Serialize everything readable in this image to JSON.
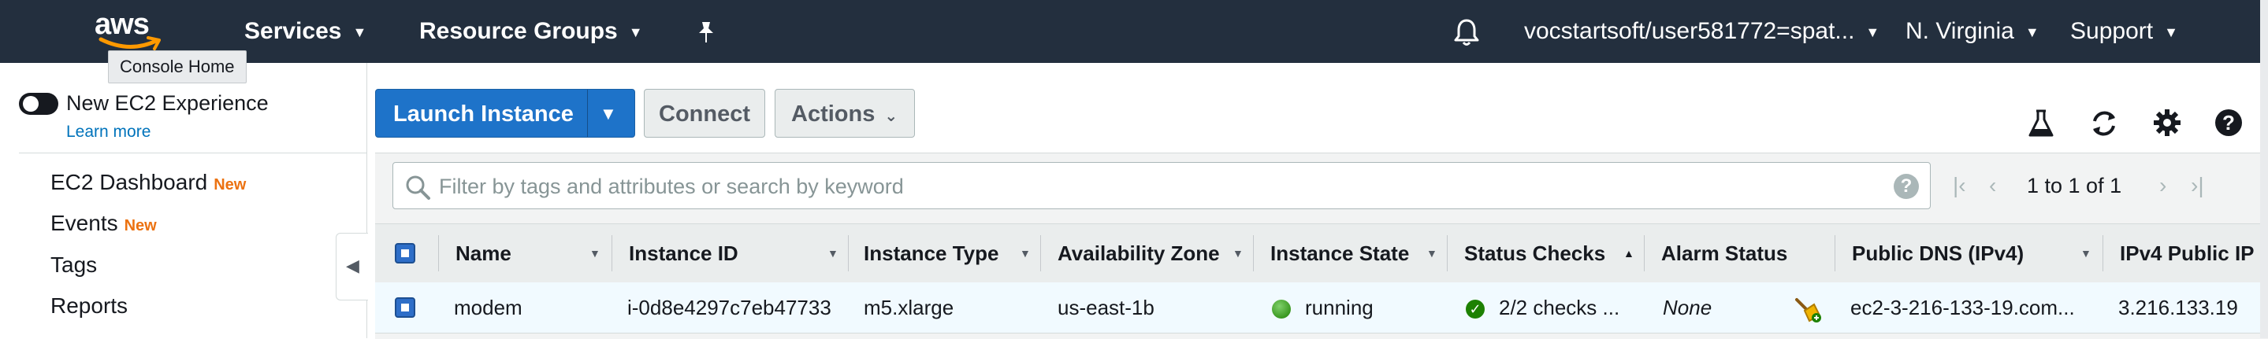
{
  "topnav": {
    "logo_text": "aws",
    "services": "Services",
    "resource_groups": "Resource Groups",
    "account": "vocstartsoft/user581772=spat...",
    "region": "N. Virginia",
    "support": "Support",
    "tooltip": "Console Home",
    "colors": {
      "background": "#232f3e",
      "text": "#ffffff",
      "logo_smile": "#ff9900"
    }
  },
  "sidebar": {
    "new_experience_label": "New EC2 Experience",
    "learn_more": "Learn more",
    "items": [
      {
        "label": "EC2 Dashboard",
        "badge": "New"
      },
      {
        "label": "Events",
        "badge": "New"
      },
      {
        "label": "Tags",
        "badge": ""
      },
      {
        "label": "Reports",
        "badge": ""
      }
    ],
    "badge_color": "#ec7211"
  },
  "toolbar": {
    "launch_instance": "Launch Instance",
    "connect": "Connect",
    "actions": "Actions",
    "launch_color": "#1e73c9",
    "icons": [
      "flask-icon",
      "refresh-icon",
      "gear-icon",
      "help-icon"
    ]
  },
  "search": {
    "placeholder": "Filter by tags and attributes or search by keyword",
    "value": ""
  },
  "pagination": {
    "text": "1 to 1 of 1"
  },
  "table": {
    "columns": [
      "Name",
      "Instance ID",
      "Instance Type",
      "Availability Zone",
      "Instance State",
      "Status Checks",
      "Alarm Status",
      "Public DNS (IPv4)",
      "IPv4 Public IP"
    ],
    "sorted_column": "Status Checks",
    "rows": [
      {
        "selected": true,
        "name": "modem",
        "instance_id": "i-0d8e4297c7eb47733",
        "instance_type": "m5.xlarge",
        "availability_zone": "us-east-1b",
        "instance_state": "running",
        "status_checks": "2/2 checks ...",
        "alarm_status": "None",
        "public_dns": "ec2-3-216-133-19.com...",
        "ipv4_public_ip": "3.216.133.19"
      }
    ],
    "state_color": "#1d8102",
    "row_selected_bg": "#f1faff"
  }
}
